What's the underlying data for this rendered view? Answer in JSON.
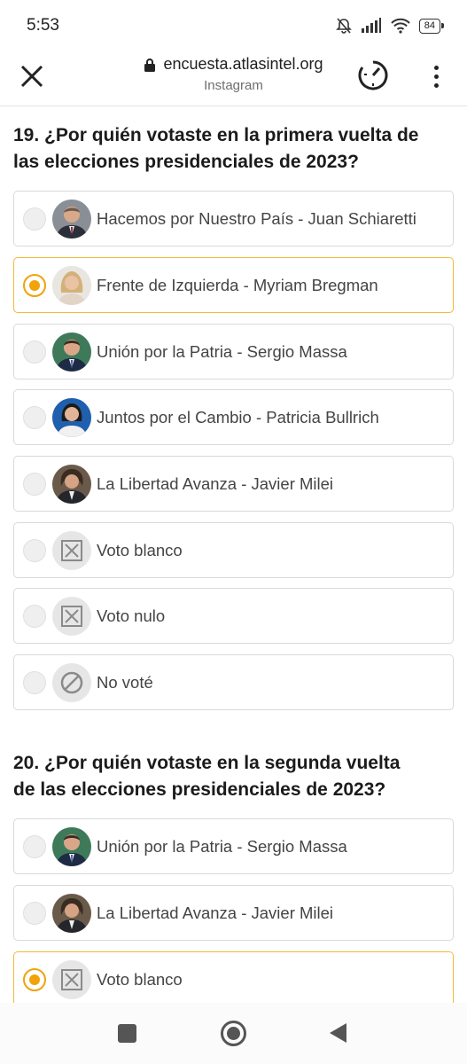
{
  "status_bar": {
    "time": "5:53",
    "battery": "84"
  },
  "browser": {
    "url": "encuesta.atlasintel.org",
    "subtitle": "Instagram"
  },
  "q19": {
    "title_line1": "19. ¿Por quién votaste en la primera vuelta de",
    "title_line2": "las elecciones presidenciales de 2023?",
    "options": [
      {
        "label": "Hacemos por Nuestro País - Juan Schiaretti",
        "icon": "schiaretti-avatar",
        "selected": false
      },
      {
        "label": "Frente de Izquierda - Myriam Bregman",
        "icon": "bregman-avatar",
        "selected": true
      },
      {
        "label": "Unión por la Patria - Sergio Massa",
        "icon": "massa-avatar",
        "selected": false
      },
      {
        "label": "Juntos por el Cambio - Patricia Bullrich",
        "icon": "bullrich-avatar",
        "selected": false
      },
      {
        "label": "La Libertad Avanza - Javier Milei",
        "icon": "milei-avatar",
        "selected": false
      },
      {
        "label": "Voto blanco",
        "icon": "x-box-icon",
        "selected": false
      },
      {
        "label": "Voto nulo",
        "icon": "x-box-icon",
        "selected": false
      },
      {
        "label": "No voté",
        "icon": "prohibited-icon",
        "selected": false
      }
    ]
  },
  "q20": {
    "title_line1": "20. ¿Por quién votaste en la segunda vuelta",
    "title_line2": "de las elecciones presidenciales de 2023?",
    "options": [
      {
        "label": "Unión por la Patria - Sergio Massa",
        "icon": "massa-avatar",
        "selected": false
      },
      {
        "label": "La Libertad Avanza - Javier Milei",
        "icon": "milei-avatar",
        "selected": false
      },
      {
        "label": "Voto blanco",
        "icon": "x-box-icon",
        "selected": true
      }
    ]
  },
  "colors": {
    "accent": "#f0a30a",
    "selected_border": "#f4b93a"
  }
}
